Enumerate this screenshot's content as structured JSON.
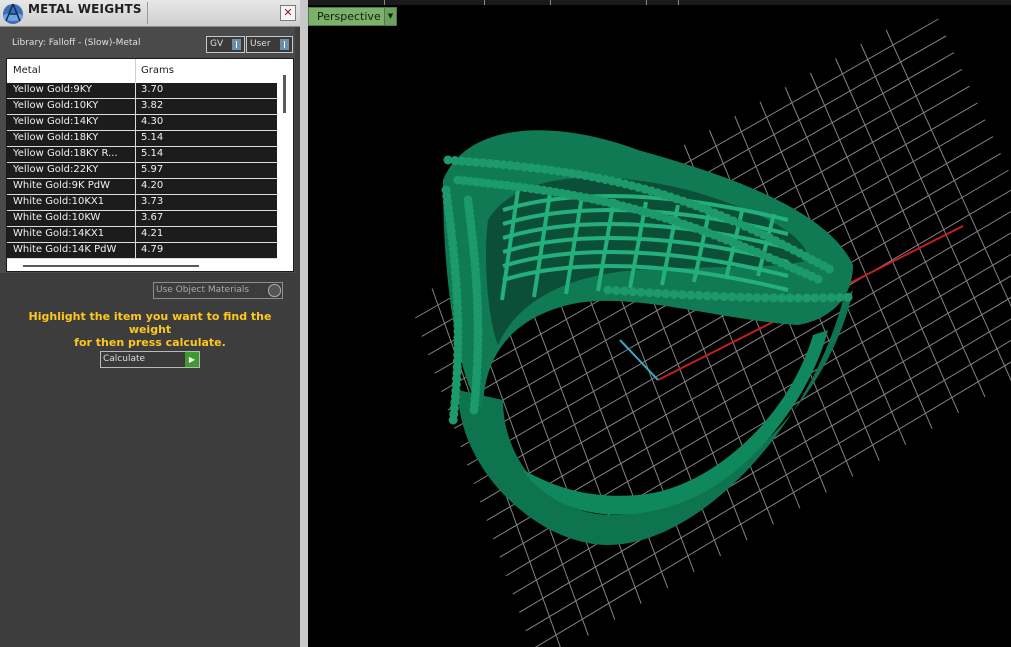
{
  "panel": {
    "title": "METAL WEIGHTS",
    "close_glyph": "✕",
    "library_label": "Library: Falloff - (Slow)-Metal",
    "gv_label": "GV",
    "user_label": "User",
    "columns": [
      "Metal",
      "Grams"
    ],
    "rows": [
      {
        "metal": "Yellow Gold:9KY",
        "grams": "3.70"
      },
      {
        "metal": "Yellow Gold:10KY",
        "grams": "3.82"
      },
      {
        "metal": "Yellow Gold:14KY",
        "grams": "4.30"
      },
      {
        "metal": "Yellow Gold:18KY",
        "grams": "5.14"
      },
      {
        "metal": "Yellow Gold:18KY R...",
        "grams": "5.14"
      },
      {
        "metal": "Yellow Gold:22KY",
        "grams": "5.97"
      },
      {
        "metal": "White Gold:9K PdW",
        "grams": "4.20"
      },
      {
        "metal": "White Gold:10KX1",
        "grams": "3.73"
      },
      {
        "metal": "White Gold:10KW",
        "grams": "3.67"
      },
      {
        "metal": "White Gold:14KX1",
        "grams": "4.21"
      },
      {
        "metal": "White Gold:14K PdW",
        "grams": "4.79"
      }
    ],
    "use_object_materials_label": "Use Object Materials",
    "hint_line1": "Highlight the item you want to find the weight",
    "hint_line2": "for then press calculate.",
    "calculate_label": "Calculate",
    "hint_color": "#ffc81e"
  },
  "viewport": {
    "view_label": "Perspective",
    "view_tab_color": "#7bb16b",
    "model_color": "#0f7a54"
  },
  "icons": {
    "app_logo": "app-logo-icon",
    "close": "close-icon",
    "dropdown": "chevron-down-icon",
    "go": "play-arrow-icon"
  }
}
